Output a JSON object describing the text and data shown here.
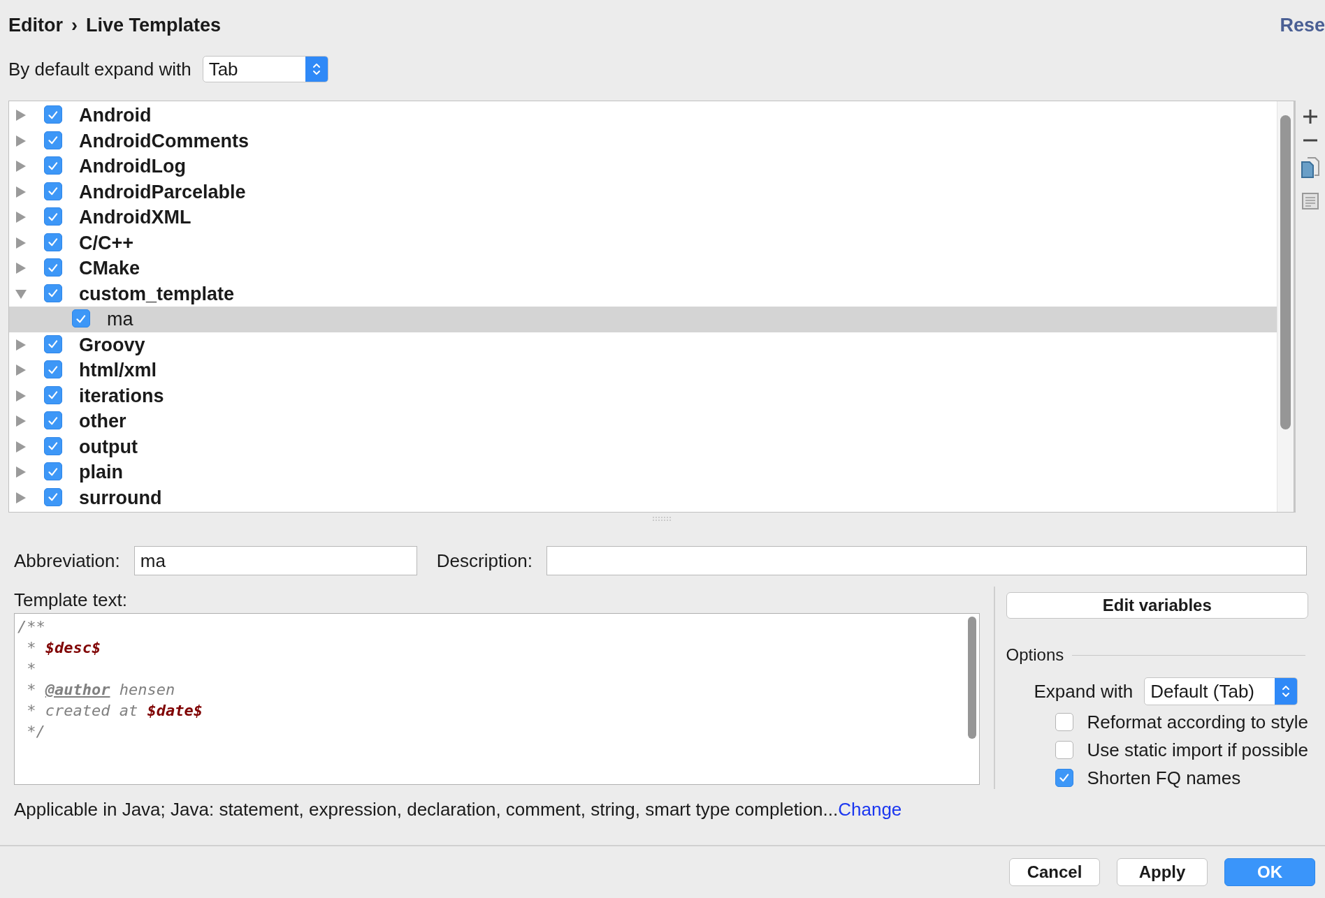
{
  "header": {
    "breadcrumb": [
      "Editor",
      "Live Templates"
    ],
    "separator": "›",
    "reset_link": "Rese"
  },
  "expand_default": {
    "label": "By default expand with",
    "value": "Tab"
  },
  "tree": [
    {
      "label": "Android",
      "checked": true,
      "expanded": false,
      "selected": false
    },
    {
      "label": "AndroidComments",
      "checked": true,
      "expanded": false,
      "selected": false
    },
    {
      "label": "AndroidLog",
      "checked": true,
      "expanded": false,
      "selected": false
    },
    {
      "label": "AndroidParcelable",
      "checked": true,
      "expanded": false,
      "selected": false
    },
    {
      "label": "AndroidXML",
      "checked": true,
      "expanded": false,
      "selected": false
    },
    {
      "label": "C/C++",
      "checked": true,
      "expanded": false,
      "selected": false
    },
    {
      "label": "CMake",
      "checked": true,
      "expanded": false,
      "selected": false
    },
    {
      "label": "custom_template",
      "checked": true,
      "expanded": true,
      "selected": false,
      "children": [
        {
          "label": "ma",
          "checked": true,
          "selected": true
        }
      ]
    },
    {
      "label": "Groovy",
      "checked": true,
      "expanded": false,
      "selected": false
    },
    {
      "label": "html/xml",
      "checked": true,
      "expanded": false,
      "selected": false
    },
    {
      "label": "iterations",
      "checked": true,
      "expanded": false,
      "selected": false
    },
    {
      "label": "other",
      "checked": true,
      "expanded": false,
      "selected": false
    },
    {
      "label": "output",
      "checked": true,
      "expanded": false,
      "selected": false
    },
    {
      "label": "plain",
      "checked": true,
      "expanded": false,
      "selected": false
    },
    {
      "label": "surround",
      "checked": true,
      "expanded": false,
      "selected": false
    }
  ],
  "abbreviation": {
    "label": "Abbreviation:",
    "value": "ma"
  },
  "description": {
    "label": "Description:"
  },
  "template_text": {
    "label": "Template text:",
    "lines": [
      [
        {
          "kind": "comment",
          "text": "/**"
        }
      ],
      [
        {
          "kind": "comment",
          "text": " * "
        },
        {
          "kind": "variable",
          "text": "$desc$"
        }
      ],
      [
        {
          "kind": "comment",
          "text": " *"
        }
      ],
      [
        {
          "kind": "comment",
          "text": " * "
        },
        {
          "kind": "tag",
          "text": "@author"
        },
        {
          "kind": "comment",
          "text": " hensen"
        }
      ],
      [
        {
          "kind": "comment",
          "text": " * created at "
        },
        {
          "kind": "variable",
          "text": "$date$"
        }
      ],
      [
        {
          "kind": "comment",
          "text": " */"
        }
      ]
    ]
  },
  "edit_variables_button": "Edit variables",
  "options": {
    "title": "Options",
    "expand_label": "Expand with",
    "expand_value": "Default (Tab)",
    "checkboxes": [
      {
        "label": "Reformat according to style",
        "checked": false
      },
      {
        "label": "Use static import if possible",
        "checked": false
      },
      {
        "label": "Shorten FQ names",
        "checked": true
      }
    ]
  },
  "applicable": {
    "text": "Applicable in Java; Java: statement, expression, declaration, comment, string, smart type completion...",
    "link": "Change"
  },
  "buttons": [
    {
      "label": "Cancel",
      "kind": "secondary"
    },
    {
      "label": "Apply",
      "kind": "secondary"
    },
    {
      "label": "OK",
      "kind": "primary"
    }
  ]
}
